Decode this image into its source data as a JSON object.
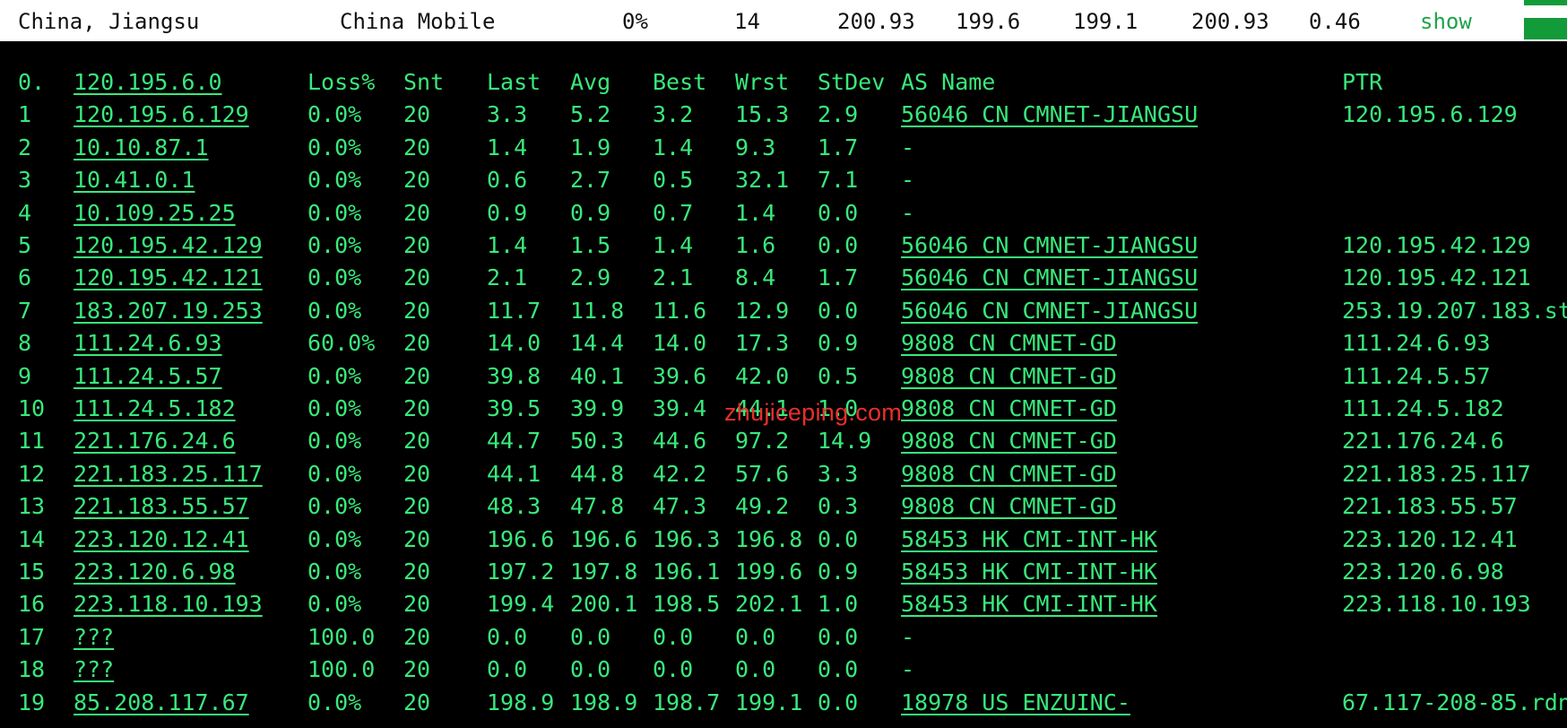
{
  "summary": {
    "location": "China, Jiangsu",
    "isp": "China Mobile",
    "loss": "0%",
    "count": "14",
    "value_a": "200.93",
    "value_b": "199.6",
    "value_c": "199.1",
    "value_d": "200.93",
    "value_e": "0.46",
    "show_label": "show"
  },
  "colors": {
    "terminal_bg": "#000000",
    "terminal_text": "#39e97b",
    "topbar_bg": "#ffffff",
    "accent_green": "#139b3a",
    "watermark": "#e8302a"
  },
  "table": {
    "header": {
      "hop": "0.",
      "host": "120.195.6.0",
      "loss": "Loss%",
      "snt": "Snt",
      "last": "Last",
      "avg": "Avg",
      "best": "Best",
      "wrst": "Wrst",
      "stdev": "StDev",
      "as_name": "AS Name",
      "ptr": "PTR"
    },
    "rows": [
      {
        "hop": "1",
        "host": "120.195.6.129",
        "loss": "0.0%",
        "snt": "20",
        "last": "3.3",
        "avg": "5.2",
        "best": "3.2",
        "wrst": "15.3",
        "stdev": "2.9",
        "as_name": "56046 CN CMNET-JIANGSU",
        "ptr": "120.195.6.129"
      },
      {
        "hop": "2",
        "host": "10.10.87.1",
        "loss": "0.0%",
        "snt": "20",
        "last": "1.4",
        "avg": "1.9",
        "best": "1.4",
        "wrst": "9.3",
        "stdev": "1.7",
        "as_name": "-",
        "ptr": ""
      },
      {
        "hop": "3",
        "host": "10.41.0.1",
        "loss": "0.0%",
        "snt": "20",
        "last": "0.6",
        "avg": "2.7",
        "best": "0.5",
        "wrst": "32.1",
        "stdev": "7.1",
        "as_name": "-",
        "ptr": ""
      },
      {
        "hop": "4",
        "host": "10.109.25.25",
        "loss": "0.0%",
        "snt": "20",
        "last": "0.9",
        "avg": "0.9",
        "best": "0.7",
        "wrst": "1.4",
        "stdev": "0.0",
        "as_name": "-",
        "ptr": ""
      },
      {
        "hop": "5",
        "host": "120.195.42.129",
        "loss": "0.0%",
        "snt": "20",
        "last": "1.4",
        "avg": "1.5",
        "best": "1.4",
        "wrst": "1.6",
        "stdev": "0.0",
        "as_name": "56046 CN CMNET-JIANGSU",
        "ptr": "120.195.42.129"
      },
      {
        "hop": "6",
        "host": "120.195.42.121",
        "loss": "0.0%",
        "snt": "20",
        "last": "2.1",
        "avg": "2.9",
        "best": "2.1",
        "wrst": "8.4",
        "stdev": "1.7",
        "as_name": "56046 CN CMNET-JIANGSU",
        "ptr": "120.195.42.121"
      },
      {
        "hop": "7",
        "host": "183.207.19.253",
        "loss": "0.0%",
        "snt": "20",
        "last": "11.7",
        "avg": "11.8",
        "best": "11.6",
        "wrst": "12.9",
        "stdev": "0.0",
        "as_name": "56046 CN CMNET-JIANGSU",
        "ptr": "253.19.207.183.st"
      },
      {
        "hop": "8",
        "host": "111.24.6.93",
        "loss": "60.0%",
        "snt": "20",
        "last": "14.0",
        "avg": "14.4",
        "best": "14.0",
        "wrst": "17.3",
        "stdev": "0.9",
        "as_name": "9808  CN CMNET-GD",
        "ptr": "111.24.6.93"
      },
      {
        "hop": "9",
        "host": "111.24.5.57",
        "loss": "0.0%",
        "snt": "20",
        "last": "39.8",
        "avg": "40.1",
        "best": "39.6",
        "wrst": "42.0",
        "stdev": "0.5",
        "as_name": "9808  CN CMNET-GD",
        "ptr": "111.24.5.57"
      },
      {
        "hop": "10",
        "host": "111.24.5.182",
        "loss": "0.0%",
        "snt": "20",
        "last": "39.5",
        "avg": "39.9",
        "best": "39.4",
        "wrst": "44.1",
        "stdev": "1.0",
        "as_name": "9808  CN CMNET-GD",
        "ptr": "111.24.5.182"
      },
      {
        "hop": "11",
        "host": "221.176.24.6",
        "loss": "0.0%",
        "snt": "20",
        "last": "44.7",
        "avg": "50.3",
        "best": "44.6",
        "wrst": "97.2",
        "stdev": "14.9",
        "as_name": "9808  CN CMNET-GD",
        "ptr": "221.176.24.6"
      },
      {
        "hop": "12",
        "host": "221.183.25.117",
        "loss": "0.0%",
        "snt": "20",
        "last": "44.1",
        "avg": "44.8",
        "best": "42.2",
        "wrst": "57.6",
        "stdev": "3.3",
        "as_name": "9808  CN CMNET-GD",
        "ptr": "221.183.25.117"
      },
      {
        "hop": "13",
        "host": "221.183.55.57",
        "loss": "0.0%",
        "snt": "20",
        "last": "48.3",
        "avg": "47.8",
        "best": "47.3",
        "wrst": "49.2",
        "stdev": "0.3",
        "as_name": "9808  CN CMNET-GD",
        "ptr": "221.183.55.57"
      },
      {
        "hop": "14",
        "host": "223.120.12.41",
        "loss": "0.0%",
        "snt": "20",
        "last": "196.6",
        "avg": "196.6",
        "best": "196.3",
        "wrst": "196.8",
        "stdev": "0.0",
        "as_name": "58453 HK CMI-INT-HK",
        "ptr": "223.120.12.41"
      },
      {
        "hop": "15",
        "host": "223.120.6.98",
        "loss": "0.0%",
        "snt": "20",
        "last": "197.2",
        "avg": "197.8",
        "best": "196.1",
        "wrst": "199.6",
        "stdev": "0.9",
        "as_name": "58453 HK CMI-INT-HK",
        "ptr": "223.120.6.98"
      },
      {
        "hop": "16",
        "host": "223.118.10.193",
        "loss": "0.0%",
        "snt": "20",
        "last": "199.4",
        "avg": "200.1",
        "best": "198.5",
        "wrst": "202.1",
        "stdev": "1.0",
        "as_name": "58453 HK CMI-INT-HK",
        "ptr": "223.118.10.193"
      },
      {
        "hop": "17",
        "host": "???",
        "loss": "100.0",
        "snt": "20",
        "last": "0.0",
        "avg": "0.0",
        "best": "0.0",
        "wrst": "0.0",
        "stdev": "0.0",
        "as_name": "-",
        "ptr": ""
      },
      {
        "hop": "18",
        "host": "???",
        "loss": "100.0",
        "snt": "20",
        "last": "0.0",
        "avg": "0.0",
        "best": "0.0",
        "wrst": "0.0",
        "stdev": "0.0",
        "as_name": "-",
        "ptr": ""
      },
      {
        "hop": "19",
        "host": "85.208.117.67",
        "loss": "0.0%",
        "snt": "20",
        "last": "198.9",
        "avg": "198.9",
        "best": "198.7",
        "wrst": "199.1",
        "stdev": "0.0",
        "as_name": "18978 US ENZUINC-",
        "ptr": "67.117-208-85.rdn"
      }
    ]
  },
  "watermark": {
    "text": "zhujiceping.com"
  }
}
